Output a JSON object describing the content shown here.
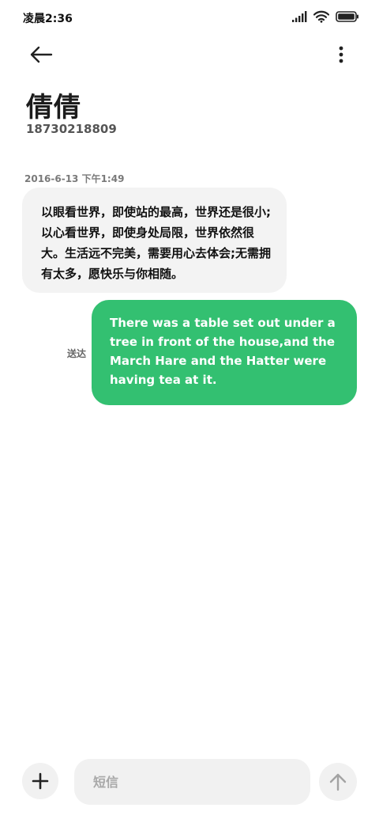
{
  "status_bar": {
    "time": "凌晨2:36",
    "icons": [
      "signal-icon",
      "wifi-icon",
      "battery-icon"
    ]
  },
  "header": {
    "back_icon": "arrow-left-icon",
    "more_icon": "more-vertical-icon",
    "contact_name": "倩倩",
    "contact_number": "18730218809"
  },
  "conversation": {
    "timestamp": "2016-6-13  下午1:49",
    "messages": [
      {
        "direction": "incoming",
        "text": "以眼看世界，即使站的最高，世界还是很小;以心看世界，即使身处局限，世界依然很大。生活远不完美，需要用心去体会;无需拥有太多，愿快乐与你相随。"
      },
      {
        "direction": "outgoing",
        "text": "There was a table set out under a tree in front of the house,and the March Hare and the Hatter were having tea at it.",
        "status": "送达"
      }
    ]
  },
  "composer": {
    "placeholder": "短信",
    "value": "",
    "add_icon": "plus-icon",
    "send_icon": "arrow-up-icon"
  },
  "colors": {
    "outgoing_bubble": "#33c071",
    "incoming_bubble": "#f3f3f3",
    "background": "#ffffff"
  }
}
